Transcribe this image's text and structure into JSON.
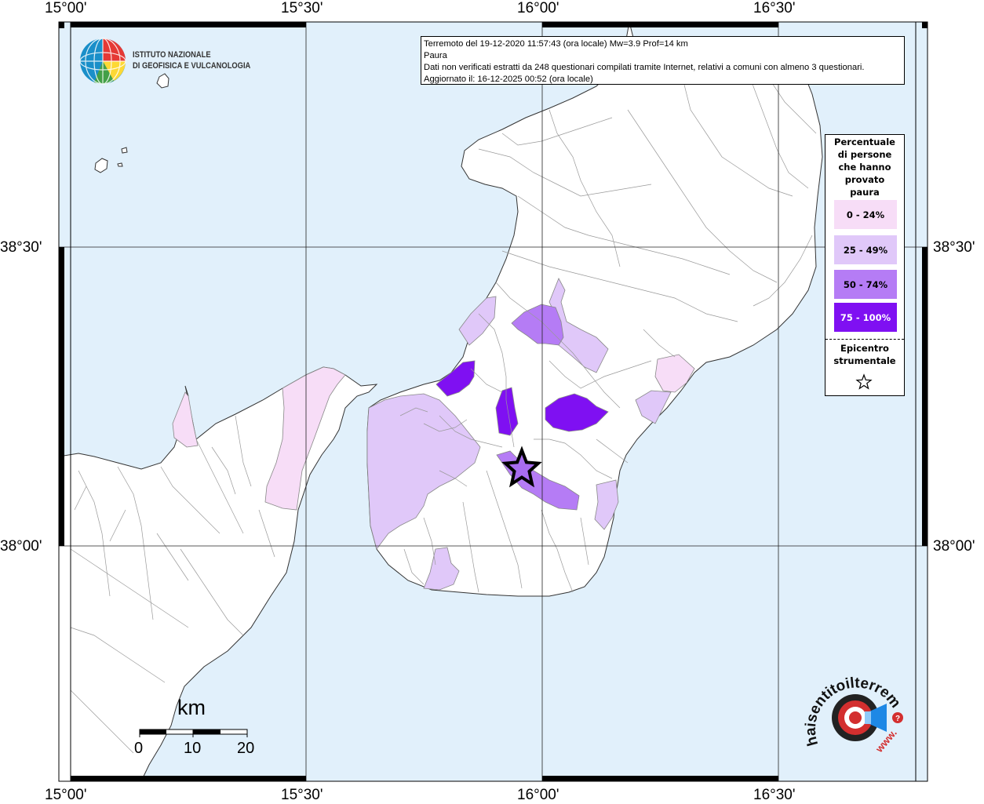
{
  "info": {
    "line1": "Terremoto del 19-12-2020 11:57:43 (ora locale) Mw=3.9 Prof=14 km",
    "line2": "Paura",
    "line3": "Dati non verificati estratti da 248 questionari compilati tramite Internet, relativi a comuni con almeno 3 questionari.",
    "line4": "Aggiornato il: 16-12-2025 00:52 (ora locale)"
  },
  "axes": {
    "top": [
      "15°00'",
      "15°30'",
      "16°00'",
      "16°30'"
    ],
    "bottom": [
      "15°00'",
      "15°30'",
      "16°00'",
      "16°30'"
    ],
    "left": [
      "38°30'",
      "38°00'"
    ],
    "right": [
      "38°30'",
      "38°00'"
    ]
  },
  "logo": {
    "line1": "ISTITUTO NAZIONALE",
    "line2": "DI GEOFISICA E VULCANOLOGIA"
  },
  "legend": {
    "title_lines": [
      "Percentuale",
      "di persone",
      "che hanno",
      "provato",
      "paura"
    ],
    "classes": [
      {
        "label": "0 - 24%",
        "color": "#f7ddf7",
        "text_color": "#000000"
      },
      {
        "label": "25 - 49%",
        "color": "#e0c8f9",
        "text_color": "#000000"
      },
      {
        "label": "50 - 74%",
        "color": "#b57cf5",
        "text_color": "#000000"
      },
      {
        "label": "75 - 100%",
        "color": "#7f10f2",
        "text_color": "#ffffff"
      }
    ],
    "epicentre_lines": [
      "Epicentro",
      "strumentale"
    ]
  },
  "scale": {
    "unit": "km",
    "ticks": [
      "0",
      "10",
      "20"
    ]
  },
  "watermark": {
    "text": "haisentitoilterremoto.it",
    "www": "www."
  },
  "colors": {
    "sea": "#e1f0fb",
    "land": "#ffffff",
    "boundary": "#999999",
    "epicentre": "#a86cf0"
  },
  "map": {
    "epicentre_label": "epicentre"
  }
}
